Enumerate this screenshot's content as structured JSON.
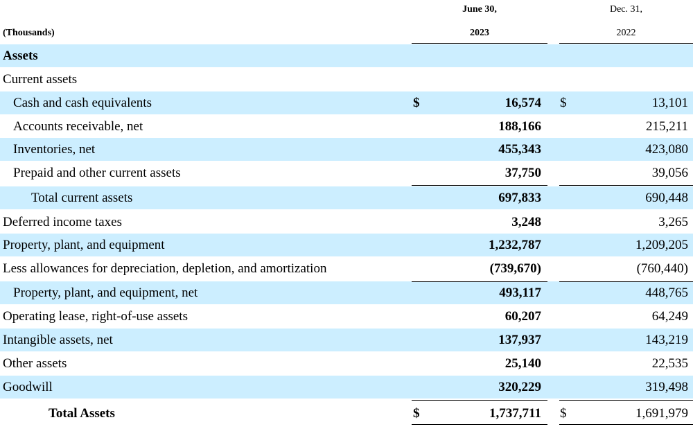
{
  "header": {
    "units_label": "(Thousands)",
    "col1_line1": "June 30,",
    "col1_line2": "2023",
    "col2_line1": "Dec. 31,",
    "col2_line2": "2022"
  },
  "rows": [
    {
      "label": "Assets",
      "bold": true,
      "shaded": true,
      "indent": 0,
      "v2023": "",
      "v2022": "",
      "dollar": false
    },
    {
      "label": "Current assets",
      "bold": false,
      "shaded": false,
      "indent": 0,
      "v2023": "",
      "v2022": "",
      "dollar": false
    },
    {
      "label": "Cash and cash equivalents",
      "bold": false,
      "shaded": true,
      "indent": 1,
      "v2023": "16,574",
      "v2022": "13,101",
      "dollar": true
    },
    {
      "label": "Accounts receivable, net",
      "bold": false,
      "shaded": false,
      "indent": 1,
      "v2023": "188,166",
      "v2022": "215,211",
      "dollar": false
    },
    {
      "label": "Inventories, net",
      "bold": false,
      "shaded": true,
      "indent": 1,
      "v2023": "455,343",
      "v2022": "423,080",
      "dollar": false
    },
    {
      "label": "Prepaid and other current assets",
      "bold": false,
      "shaded": false,
      "indent": 1,
      "v2023": "37,750",
      "v2022": "39,056",
      "dollar": false
    },
    {
      "label": "Total current assets",
      "bold": false,
      "shaded": true,
      "indent": 2,
      "v2023": "697,833",
      "v2022": "690,448",
      "dollar": false
    },
    {
      "label": "Deferred income taxes",
      "bold": false,
      "shaded": false,
      "indent": 0,
      "v2023": "3,248",
      "v2022": "3,265",
      "dollar": false
    },
    {
      "label": "Property, plant, and equipment",
      "bold": false,
      "shaded": true,
      "indent": 0,
      "v2023": "1,232,787",
      "v2022": "1,209,205",
      "dollar": false
    },
    {
      "label": "Less allowances for depreciation, depletion, and amortization",
      "bold": false,
      "shaded": false,
      "indent": 0,
      "v2023": "(739,670)",
      "v2022": "(760,440)",
      "dollar": false
    },
    {
      "label": "Property, plant, and equipment, net",
      "bold": false,
      "shaded": true,
      "indent": 1,
      "v2023": "493,117",
      "v2022": "448,765",
      "dollar": false
    },
    {
      "label": "Operating lease, right-of-use assets",
      "bold": false,
      "shaded": false,
      "indent": 0,
      "v2023": "60,207",
      "v2022": "64,249",
      "dollar": false
    },
    {
      "label": "Intangible assets, net",
      "bold": false,
      "shaded": true,
      "indent": 0,
      "v2023": "137,937",
      "v2022": "143,219",
      "dollar": false
    },
    {
      "label": "Other assets",
      "bold": false,
      "shaded": false,
      "indent": 0,
      "v2023": "25,140",
      "v2022": "22,535",
      "dollar": false
    },
    {
      "label": "Goodwill",
      "bold": false,
      "shaded": true,
      "indent": 0,
      "v2023": "320,229",
      "v2022": "319,498",
      "dollar": false
    },
    {
      "label": "Total Assets",
      "bold": true,
      "shaded": false,
      "indent": 3,
      "v2023": "1,737,711",
      "v2022": "1,691,979",
      "dollar": true
    }
  ],
  "currency_symbol": "$"
}
